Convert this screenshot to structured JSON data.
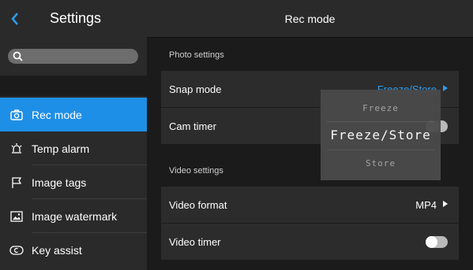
{
  "sidebar": {
    "title": "Settings",
    "search_placeholder": "",
    "items": [
      {
        "label": "Rec mode",
        "icon": "camera-icon",
        "active": true
      },
      {
        "label": "Temp alarm",
        "icon": "alarm-icon",
        "active": false
      },
      {
        "label": "Image tags",
        "icon": "flag-icon",
        "active": false
      },
      {
        "label": "Image watermark",
        "icon": "image-icon",
        "active": false
      },
      {
        "label": "Key assist",
        "icon": "key-icon",
        "active": false
      }
    ]
  },
  "main": {
    "title": "Rec mode",
    "photo_section": "Photo settings",
    "snap_mode_label": "Snap mode",
    "snap_mode_value": "Freeze/Store",
    "cam_timer_label": "Cam timer",
    "video_section": "Video settings",
    "video_format_label": "Video format",
    "video_format_value": "MP4",
    "video_timer_label": "Video timer"
  },
  "picker": {
    "options": [
      "Freeze",
      "Freeze/Store",
      "Store"
    ],
    "selected": "Freeze/Store"
  },
  "colors": {
    "accent": "#1e8fe6",
    "value_blue": "#2d9cf0"
  }
}
